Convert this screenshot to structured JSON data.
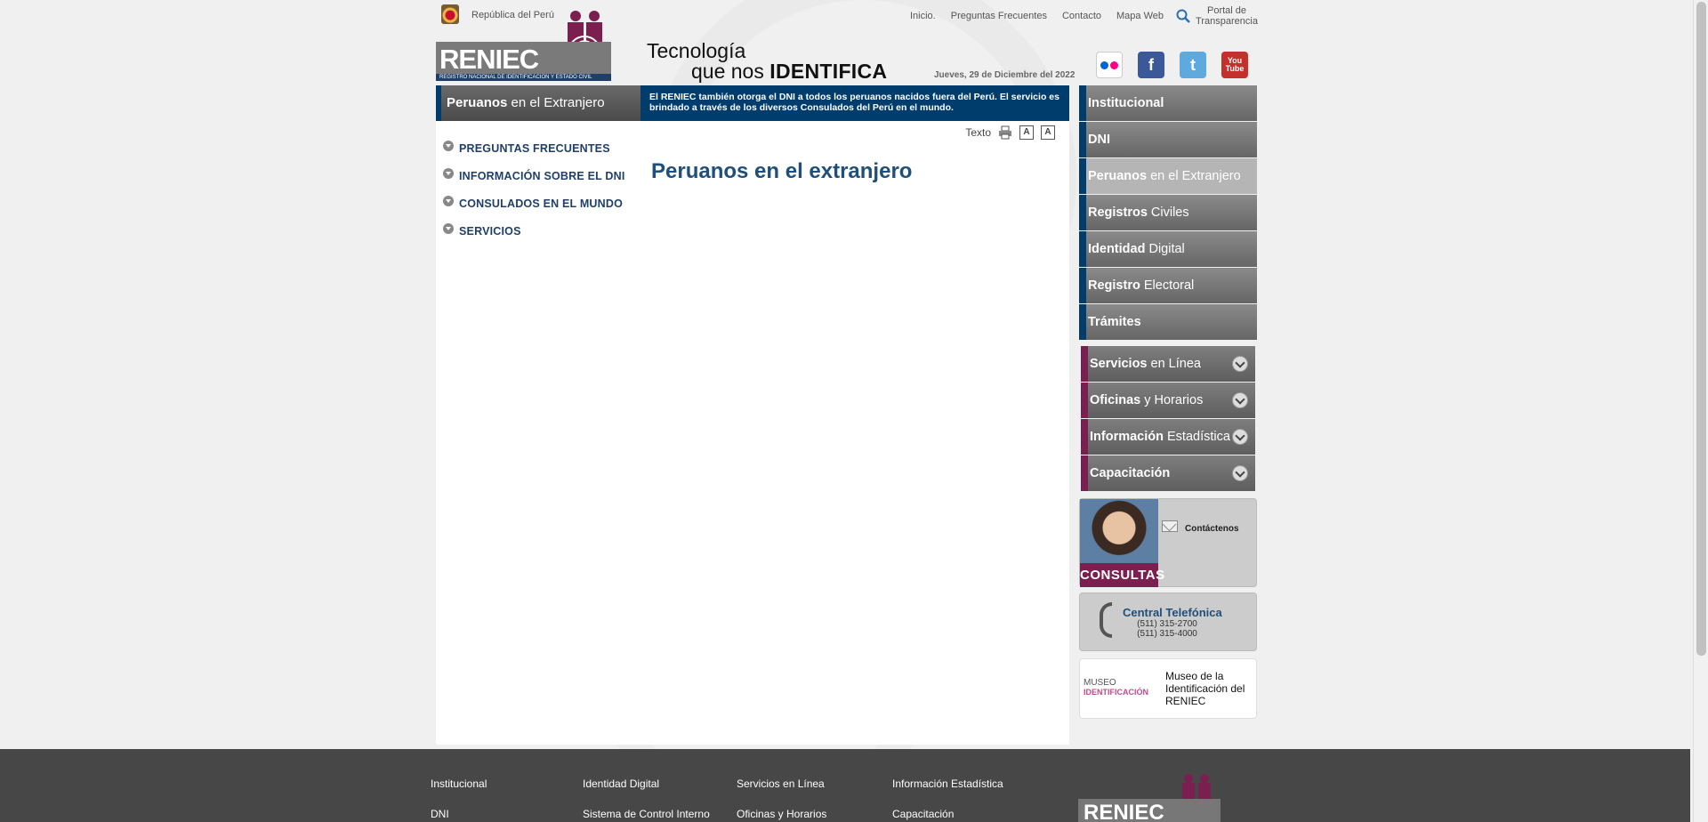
{
  "header": {
    "republica": "República del Perú",
    "toplinks": [
      "Inicio.",
      "Preguntas Frecuentes",
      "Contacto",
      "Mapa Web"
    ],
    "portal": [
      "Portal de",
      "Transparencia"
    ],
    "logo_word": "RENIEC",
    "logo_sub": "REGISTRO NACIONAL DE IDENTIFICACIÓN Y ESTADO CIVIL",
    "tagline_1": "Tecnología",
    "tagline_2a": "que nos ",
    "tagline_2b": "IDENTIFICA",
    "date": "Jueves, 29 de Diciembre del 2022",
    "social": [
      "flickr-icon",
      "facebook-icon",
      "twitter-icon",
      "youtube-icon"
    ]
  },
  "section": {
    "title_bold": "Peruanos",
    "title_rest": " en el Extranjero",
    "description": "El RENIEC también otorga el DNI a todos los peruanos nacidos fuera del Perú. El servicio es brindado a través de los diversos Consulados del Perú en el mundo.",
    "text_tools_label": "Texto",
    "heading": "Peruanos en el extranjero"
  },
  "left_menu": [
    "PREGUNTAS FRECUENTES",
    "INFORMACIÓN SOBRE EL DNI",
    "CONSULADOS EN EL MUNDO",
    "SERVICIOS"
  ],
  "right_menu": [
    {
      "bold": "Institucional",
      "rest": ""
    },
    {
      "bold": "DNI",
      "rest": ""
    },
    {
      "bold": "Peruanos",
      "rest": " en el Extranjero"
    },
    {
      "bold": "Registros",
      "rest": " Civiles"
    },
    {
      "bold": "Identidad",
      "rest": " Digital"
    },
    {
      "bold": "Registro",
      "rest": " Electoral"
    },
    {
      "bold": "Trámites",
      "rest": ""
    }
  ],
  "right_menu2": [
    {
      "bold": "Servicios",
      "rest": " en Línea"
    },
    {
      "bold": "Oficinas",
      "rest": " y Horarios"
    },
    {
      "bold": "Información",
      "rest": " Estadística"
    },
    {
      "bold": "Capacitación",
      "rest": ""
    }
  ],
  "consultas": {
    "button": "CONSULTAS",
    "contact": "Contáctenos"
  },
  "central": {
    "title": "Central Telefónica",
    "phone1": "(511) 315-2700",
    "phone2": "(511) 315-4000"
  },
  "museo": {
    "logo_text": "MUSEO",
    "logo_sub": "IDENTIFICACIÓN",
    "text": "Museo de la Identificación del RENIEC"
  },
  "footer": {
    "col1": [
      "Institucional",
      "DNI"
    ],
    "col2": [
      "Identidad Digital",
      "Sistema de Control Interno"
    ],
    "col3": [
      "Servicios en Línea",
      "Oficinas y Horarios"
    ],
    "col4": [
      "Información Estadística",
      "Capacitación"
    ],
    "logo_word": "RENIEC"
  },
  "colors": {
    "navy": "#003c6c",
    "maroon": "#7a1f4f",
    "gray": "#6a6a6a"
  }
}
